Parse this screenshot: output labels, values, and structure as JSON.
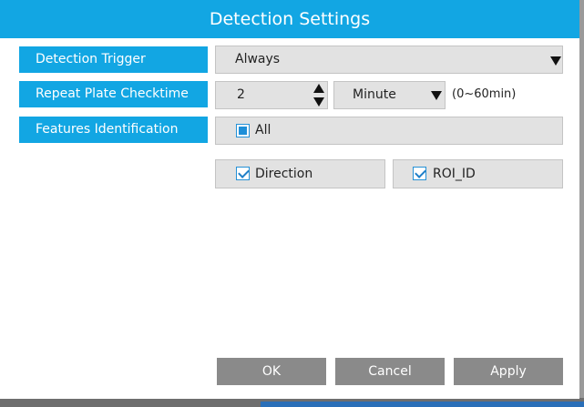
{
  "dialog": {
    "title": "Detection Settings"
  },
  "rows": {
    "detection_trigger": {
      "label": "Detection Trigger",
      "value": "Always"
    },
    "repeat_plate_checktime": {
      "label": "Repeat Plate Checktime",
      "value": "2",
      "unit": "Minute",
      "range": "(0~60min)"
    },
    "features_identification": {
      "label": "Features Identification",
      "all_label": "All",
      "all_state": "partial",
      "options": [
        {
          "label": "Direction",
          "checked": true
        },
        {
          "label": "ROI_ID",
          "checked": true
        }
      ]
    }
  },
  "buttons": {
    "ok": "OK",
    "cancel": "Cancel",
    "apply": "Apply"
  },
  "colors": {
    "accent": "#12a6e3",
    "button": "#8a8a8a",
    "field": "#e2e2e2"
  }
}
